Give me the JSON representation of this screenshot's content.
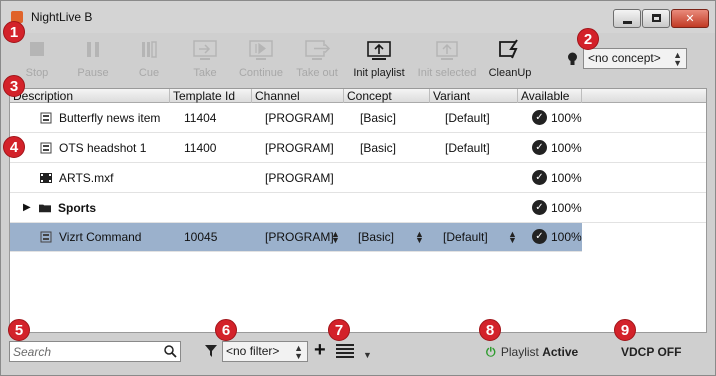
{
  "window": {
    "title": "NightLive B"
  },
  "window_controls": {
    "minimize": "minimize",
    "maximize": "maximize",
    "close": "✕"
  },
  "toolbar": {
    "buttons": [
      {
        "label": "Stop",
        "icon": "stop-icon",
        "enabled": false
      },
      {
        "label": "Pause",
        "icon": "pause-icon",
        "enabled": false
      },
      {
        "label": "Cue",
        "icon": "cue-icon",
        "enabled": false
      },
      {
        "label": "Take",
        "icon": "take-icon",
        "enabled": false
      },
      {
        "label": "Continue",
        "icon": "continue-icon",
        "enabled": false
      },
      {
        "label": "Take out",
        "icon": "take-out-icon",
        "enabled": false
      },
      {
        "label": "Init playlist",
        "icon": "init-playlist-icon",
        "enabled": true
      },
      {
        "label": "Init selected",
        "icon": "init-selected-icon",
        "enabled": false
      },
      {
        "label": "CleanUp",
        "icon": "cleanup-icon",
        "enabled": true
      }
    ],
    "concept_select": "<no concept>"
  },
  "grid": {
    "columns": [
      "Description",
      "Template Id",
      "Channel",
      "Concept",
      "Variant",
      "Available"
    ],
    "rows": [
      {
        "name": "Butterfly news item",
        "template_id": "11404",
        "channel": "[PROGRAM]",
        "concept": "[Basic]",
        "variant": "[Default]",
        "available": "100%"
      },
      {
        "name": "OTS headshot 1",
        "template_id": "11400",
        "channel": "[PROGRAM]",
        "concept": "[Basic]",
        "variant": "[Default]",
        "available": "100%"
      },
      {
        "name": "ARTS.mxf",
        "template_id": "",
        "channel": "[PROGRAM]",
        "concept": "",
        "variant": "",
        "available": "100%"
      },
      {
        "name": "Sports",
        "template_id": "",
        "channel": "",
        "concept": "",
        "variant": "",
        "available": "100%"
      },
      {
        "name": "Vizrt Command",
        "template_id": "10045",
        "channel": "[PROGRAM]",
        "concept": "[Basic]",
        "variant": "[Default]",
        "available": "100%"
      }
    ]
  },
  "bottom": {
    "search_placeholder": "Search",
    "filter_select": "<no filter>",
    "playlist_prefix": "Playlist",
    "playlist_state": "Active",
    "vdcp": "VDCP OFF"
  },
  "callouts": [
    "1",
    "2",
    "3",
    "4",
    "5",
    "6",
    "7",
    "8",
    "9"
  ],
  "colors": {
    "callout": "#d3222a",
    "selection": "#9bb1cc",
    "active_power": "#2d9b2d"
  }
}
